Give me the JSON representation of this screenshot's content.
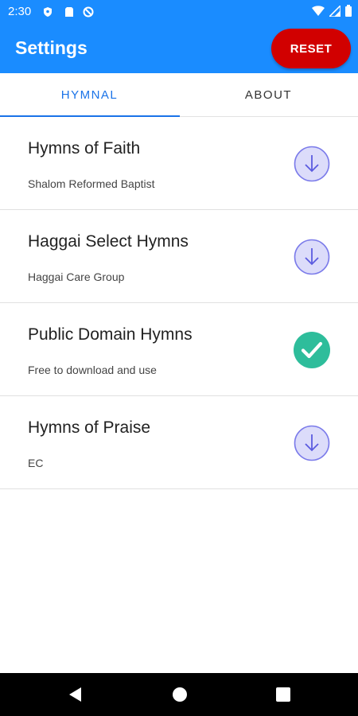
{
  "status": {
    "time": "2:30",
    "icons": [
      "shield-icon",
      "sim-icon",
      "sync-off-icon"
    ],
    "right_icons": [
      "wifi-icon",
      "signal-icon",
      "battery-icon"
    ]
  },
  "header": {
    "title": "Settings",
    "reset_label": "RESET",
    "bar_color": "#1a8cff",
    "reset_color": "#d10000"
  },
  "tabs": [
    {
      "label": "HYMNAL",
      "active": true
    },
    {
      "label": "ABOUT",
      "active": false
    }
  ],
  "hymnals": [
    {
      "title": "Hymns of Faith",
      "subtitle": "Shalom Reformed Baptist",
      "status": "download",
      "icon": "download-icon"
    },
    {
      "title": "Haggai Select Hymns",
      "subtitle": "Haggai Care Group",
      "status": "download",
      "icon": "download-icon"
    },
    {
      "title": "Public Domain Hymns",
      "subtitle": "Free to download and use",
      "status": "downloaded",
      "icon": "check-icon"
    },
    {
      "title": "Hymns of Praise",
      "subtitle": "EC",
      "status": "download",
      "icon": "download-icon"
    }
  ],
  "navbar": {
    "icons": [
      "back-icon",
      "home-icon",
      "recents-icon"
    ]
  }
}
